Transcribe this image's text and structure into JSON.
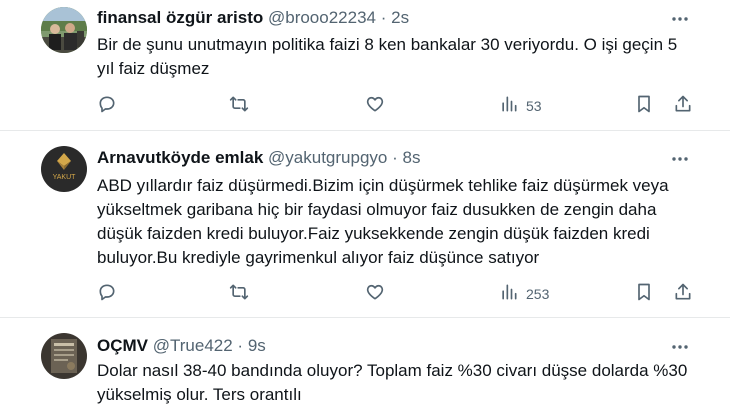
{
  "tweets": [
    {
      "name": "finansal özgür aristo",
      "handle": "@brooo22234",
      "separator": "·",
      "time": "2s",
      "text": "Bir de şunu unutmayın politika faizi 8 ken bankalar 30 veriyordu. O işi geçin 5 yıl faiz düşmez",
      "views": "53"
    },
    {
      "name": "Arnavutköyde emlak",
      "handle": "@yakutgrupgyo",
      "separator": "·",
      "time": "8s",
      "avatar_text": "YAKUT",
      "text": "ABD yıllardır faiz düşürmedi.Bizim için düşürmek tehlike faiz düşürmek veya yükseltmek garibana hiç bir faydasi olmuyor faiz dusukken de zengin daha düşük faizden kredi buluyor.Faiz yuksekkende zengin düşük faizden kredi buluyor.Bu krediyle gayrimenkul alıyor faiz düşünce satıyor",
      "views": "253"
    },
    {
      "name": "OÇMV",
      "handle": "@True422",
      "separator": "·",
      "time": "9s",
      "text": "Dolar nasıl 38-40 bandında oluyor? Toplam faiz %30 civarı düşse dolarda %30 yükselmiş olur. Ters orantılı"
    }
  ],
  "icons": {
    "reply": "reply-icon",
    "retweet": "retweet-icon",
    "like": "heart-icon",
    "views": "views-chart-icon",
    "bookmark": "bookmark-icon",
    "share": "share-icon",
    "more": "more-icon"
  },
  "colors": {
    "text": "#0f1419",
    "secondary": "#536471",
    "divider": "#e7e9ea"
  }
}
